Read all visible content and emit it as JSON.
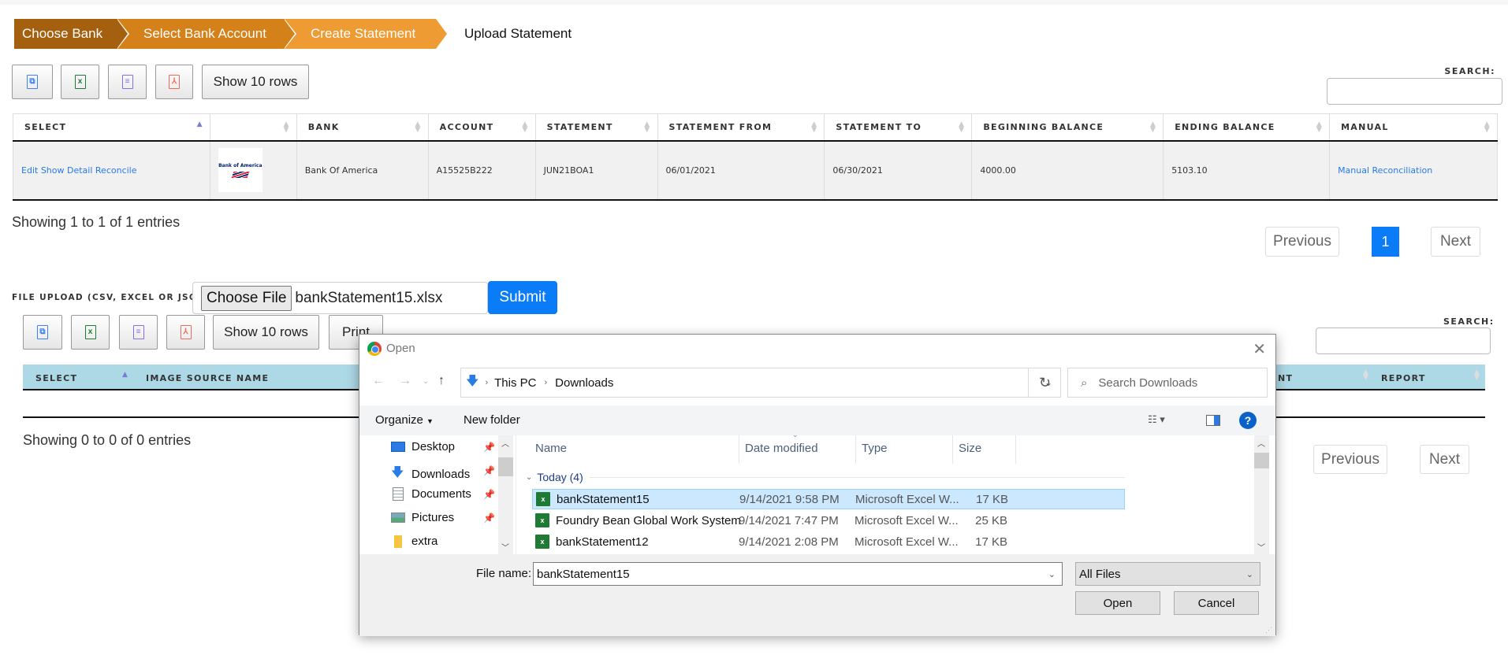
{
  "breadcrumb": [
    "Choose Bank",
    "Select Bank Account",
    "Create Statement",
    "Upload Statement"
  ],
  "toolbar1": {
    "icons": [
      "copy-icon",
      "excel-icon",
      "csv-icon",
      "pdf-icon"
    ],
    "show_rows": "Show 10 rows"
  },
  "search1": {
    "label": "SEARCH:",
    "value": ""
  },
  "table1": {
    "columns": [
      "SELECT",
      "",
      "BANK",
      "ACCOUNT",
      "STATEMENT",
      "STATEMENT FROM",
      "STATEMENT TO",
      "BEGINNING BALANCE",
      "ENDING BALANCE",
      "MANUAL"
    ],
    "rows": [
      {
        "actions": [
          "Edit",
          "Show Detail",
          "Reconcile"
        ],
        "logo": "Bank of America",
        "bank": "Bank Of America",
        "account": "A15525B222",
        "statement": "JUN21BOA1",
        "statement_from": "06/01/2021",
        "statement_to": "06/30/2021",
        "beginning_balance": "4000.00",
        "ending_balance": "5103.10",
        "manual": "Manual Reconciliation"
      }
    ],
    "info": "Showing 1 to 1 of 1 entries",
    "pagination": {
      "previous": "Previous",
      "current": "1",
      "next": "Next"
    }
  },
  "upload": {
    "label": "FILE UPLOAD (CSV, EXCEL OR JSON)",
    "choose_file": "Choose File",
    "file_name": "bankStatement15.xlsx",
    "submit": "Submit"
  },
  "toolbar2": {
    "show_rows": "Show 10 rows",
    "print": "Print"
  },
  "search2": {
    "label": "SEARCH:",
    "value": ""
  },
  "table2": {
    "columns": [
      "SELECT",
      "IMAGE SOURCE NAME",
      "NT",
      "REPORT"
    ],
    "info": "Showing 0 to 0 of 0 entries",
    "pagination": {
      "previous": "Previous",
      "next": "Next"
    }
  },
  "dialog": {
    "title": "Open",
    "path": [
      "This PC",
      "Downloads"
    ],
    "search_placeholder": "Search Downloads",
    "organize": "Organize",
    "new_folder": "New folder",
    "nav_items": [
      {
        "label": "Desktop",
        "icon": "desktop-icon",
        "pinned": true
      },
      {
        "label": "Downloads",
        "icon": "download-icon",
        "pinned": true
      },
      {
        "label": "Documents",
        "icon": "documents-icon",
        "pinned": true
      },
      {
        "label": "Pictures",
        "icon": "pictures-icon",
        "pinned": true
      },
      {
        "label": "extra",
        "icon": "folder-icon",
        "pinned": false
      }
    ],
    "columns": [
      "Name",
      "Date modified",
      "Type",
      "Size"
    ],
    "group": "Today (4)",
    "files": [
      {
        "name": "bankStatement15",
        "date": "9/14/2021 9:58 PM",
        "type": "Microsoft Excel W...",
        "size": "17 KB",
        "selected": true
      },
      {
        "name": "Foundry Bean Global Work System",
        "date": "9/14/2021 7:47 PM",
        "type": "Microsoft Excel W...",
        "size": "25 KB",
        "selected": false
      },
      {
        "name": "bankStatement12",
        "date": "9/14/2021 2:08 PM",
        "type": "Microsoft Excel W...",
        "size": "17 KB",
        "selected": false
      }
    ],
    "file_name_label": "File name:",
    "file_name_value": "bankStatement15",
    "file_type": "All Files",
    "open": "Open",
    "cancel": "Cancel"
  }
}
